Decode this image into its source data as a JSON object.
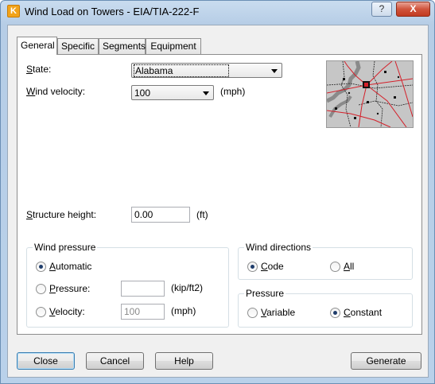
{
  "window": {
    "title": "Wind Load on Towers - EIA/TIA-222-F",
    "app_icon_letter": "K",
    "help_glyph": "?",
    "close_glyph": "X"
  },
  "tabs": [
    "General",
    "Specific",
    "Segments",
    "Equipment"
  ],
  "active_tab": "General",
  "general": {
    "state_label_pre": "",
    "state_label_mn": "S",
    "state_label_post": "tate:",
    "state_value": "Alabama",
    "wind_label_mn": "W",
    "wind_label_post": "ind velocity:",
    "wind_value": "100",
    "wind_unit": "(mph)",
    "height_label_pre": "",
    "height_label_mn": "S",
    "height_label_post": "tructure height:",
    "height_value": "0.00",
    "height_unit": "(ft)"
  },
  "wind_pressure": {
    "title": "Wind pressure",
    "automatic_mn": "A",
    "automatic_post": "utomatic",
    "pressure_mn": "P",
    "pressure_post": "ressure:",
    "pressure_value": "",
    "pressure_unit": "(kip/ft2)",
    "velocity_mn": "V",
    "velocity_post": "elocity:",
    "velocity_value": "100",
    "velocity_unit": "(mph)",
    "selected": "Automatic"
  },
  "wind_directions": {
    "title": "Wind directions",
    "code_mn": "C",
    "code_post": "ode",
    "all_mn": "A",
    "all_post": "ll",
    "selected": "Code"
  },
  "pressure": {
    "title": "Pressure",
    "variable_mn": "V",
    "variable_post": "ariable",
    "constant_mn": "C",
    "constant_post": "onstant",
    "selected": "Constant"
  },
  "buttons": {
    "close": "Close",
    "cancel": "Cancel",
    "help": "Help",
    "generate": "Generate"
  },
  "colors": {
    "map_roads": "#d4202a",
    "map_water": "#8a8a8a",
    "map_background": "#c8c8c8"
  }
}
